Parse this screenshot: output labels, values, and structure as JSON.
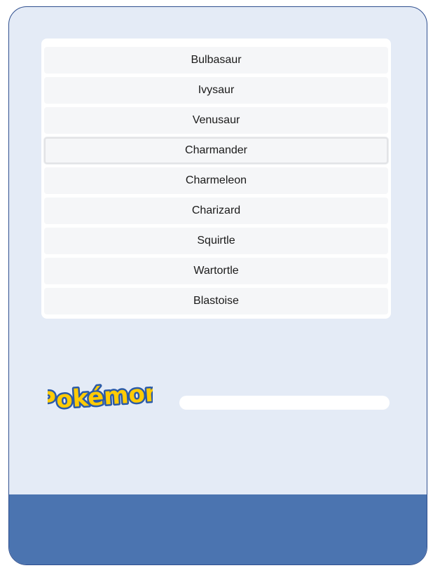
{
  "pokemon_list": {
    "items": [
      {
        "label": "Bulbasaur"
      },
      {
        "label": "Ivysaur"
      },
      {
        "label": "Venusaur"
      },
      {
        "label": "Charmander"
      },
      {
        "label": "Charmeleon"
      },
      {
        "label": "Charizard"
      },
      {
        "label": "Squirtle"
      },
      {
        "label": "Wartortle"
      },
      {
        "label": "Blastoise"
      }
    ],
    "selected_index": 3
  },
  "logo": {
    "text": "Pokémon",
    "fill_color": "#ffcb05",
    "outline_color": "#2a5aa8"
  },
  "progress": {
    "value": 0
  },
  "colors": {
    "background": "#e4ebf6",
    "border": "#2f4f8f",
    "footer": "#4b74b0"
  }
}
